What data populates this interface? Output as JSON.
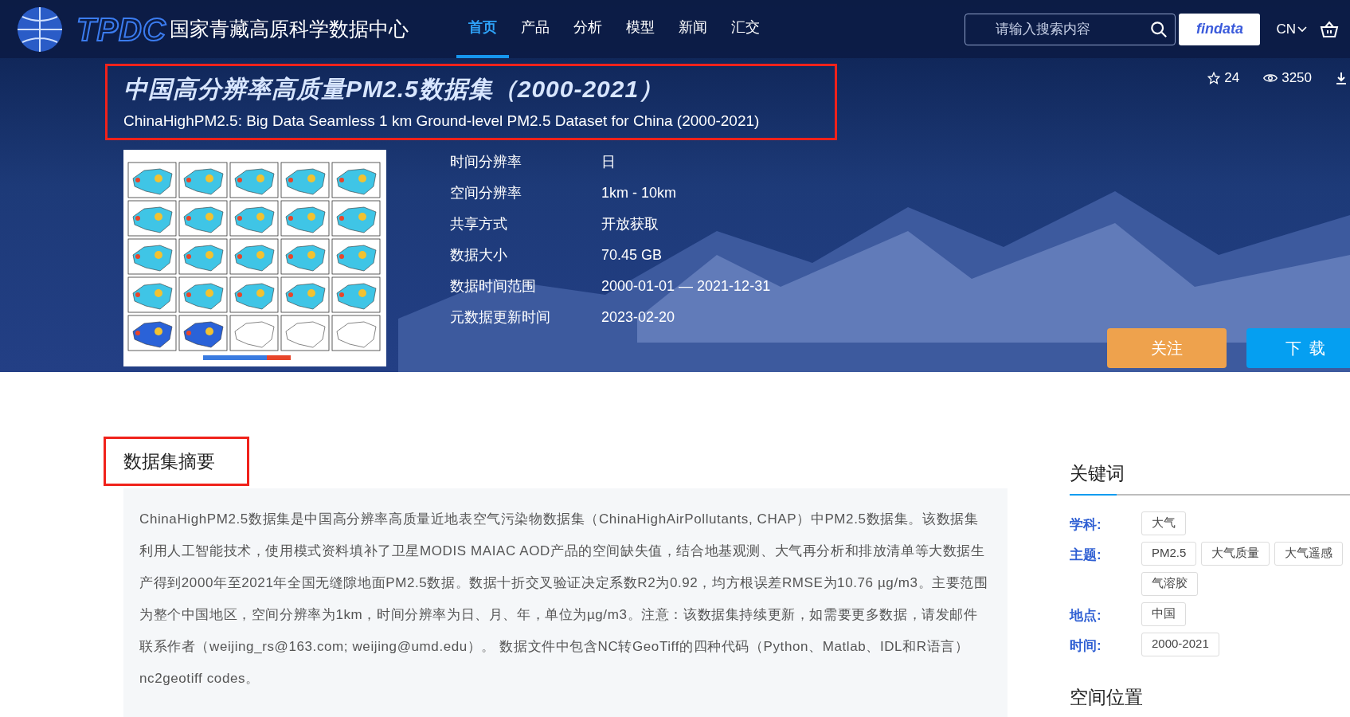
{
  "header": {
    "logo_text": "TPDC",
    "site_name": "国家青藏高原科学数据中心",
    "nav": [
      {
        "label": "首页",
        "selected": true
      },
      {
        "label": "产品",
        "selected": false
      },
      {
        "label": "分析",
        "selected": false
      },
      {
        "label": "模型",
        "selected": false
      },
      {
        "label": "新闻",
        "selected": false
      },
      {
        "label": "汇交",
        "selected": false
      }
    ],
    "search": {
      "placeholder": "请输入搜索内容"
    },
    "findata": "findata",
    "language": "CN"
  },
  "dataset": {
    "title": "中国高分辨率高质量PM2.5数据集（2000-2021）",
    "subtitle": "ChinaHighPM2.5: Big Data Seamless 1 km Ground-level PM2.5 Dataset for China (2000-2021)",
    "stats": [
      {
        "kind": "star",
        "value": "24"
      },
      {
        "kind": "views",
        "value": "3250"
      },
      {
        "kind": "download"
      }
    ],
    "info": [
      {
        "label": "时间分辨率",
        "value": "日"
      },
      {
        "label": "空间分辨率",
        "value": "1km - 10km"
      },
      {
        "label": "共享方式",
        "value": "开放获取"
      },
      {
        "label": "数据大小",
        "value": "70.45 GB"
      },
      {
        "label": "数据时间范围",
        "value": "2000-01-01 — 2021-12-31"
      },
      {
        "label": "元数据更新时间",
        "value": "2023-02-20"
      }
    ],
    "buttons": [
      {
        "kind": "follow",
        "label": "关注"
      },
      {
        "kind": "download",
        "label": "下 载"
      }
    ]
  },
  "abstract": {
    "heading": "数据集摘要",
    "text": "ChinaHighPM2.5数据集是中国高分辨率高质量近地表空气污染物数据集（ChinaHighAirPollutants, CHAP）中PM2.5数据集。该数据集利用人工智能技术，使用模式资料填补了卫星MODIS MAIAC AOD产品的空间缺失值，结合地基观测、大气再分析和排放清单等大数据生产得到2000年至2021年全国无缝隙地面PM2.5数据。数据十折交叉验证决定系数R2为0.92，均方根误差RMSE为10.76 µg/m3。主要范围为整个中国地区，空间分辨率为1km，时间分辨率为日、月、年，单位为µg/m3。注意：该数据集持续更新，如需要更多数据，请发邮件联系作者（weijing_rs@163.com; weijing@umd.edu）。 数据文件中包含NC转GeoTiff的四种代码（Python、Matlab、IDL和R语言）nc2geotiff codes。"
  },
  "keywords": {
    "heading": "关键词",
    "groups": [
      {
        "label": "学科:",
        "tags": [
          "大气"
        ]
      },
      {
        "label": "主题:",
        "tags": [
          "PM2.5",
          "大气质量",
          "大气遥感",
          "气溶胶"
        ]
      },
      {
        "label": "地点:",
        "tags": [
          "中国"
        ]
      },
      {
        "label": "时间:",
        "tags": [
          "2000-2021"
        ]
      }
    ]
  },
  "spatial": {
    "heading": "空间位置"
  }
}
